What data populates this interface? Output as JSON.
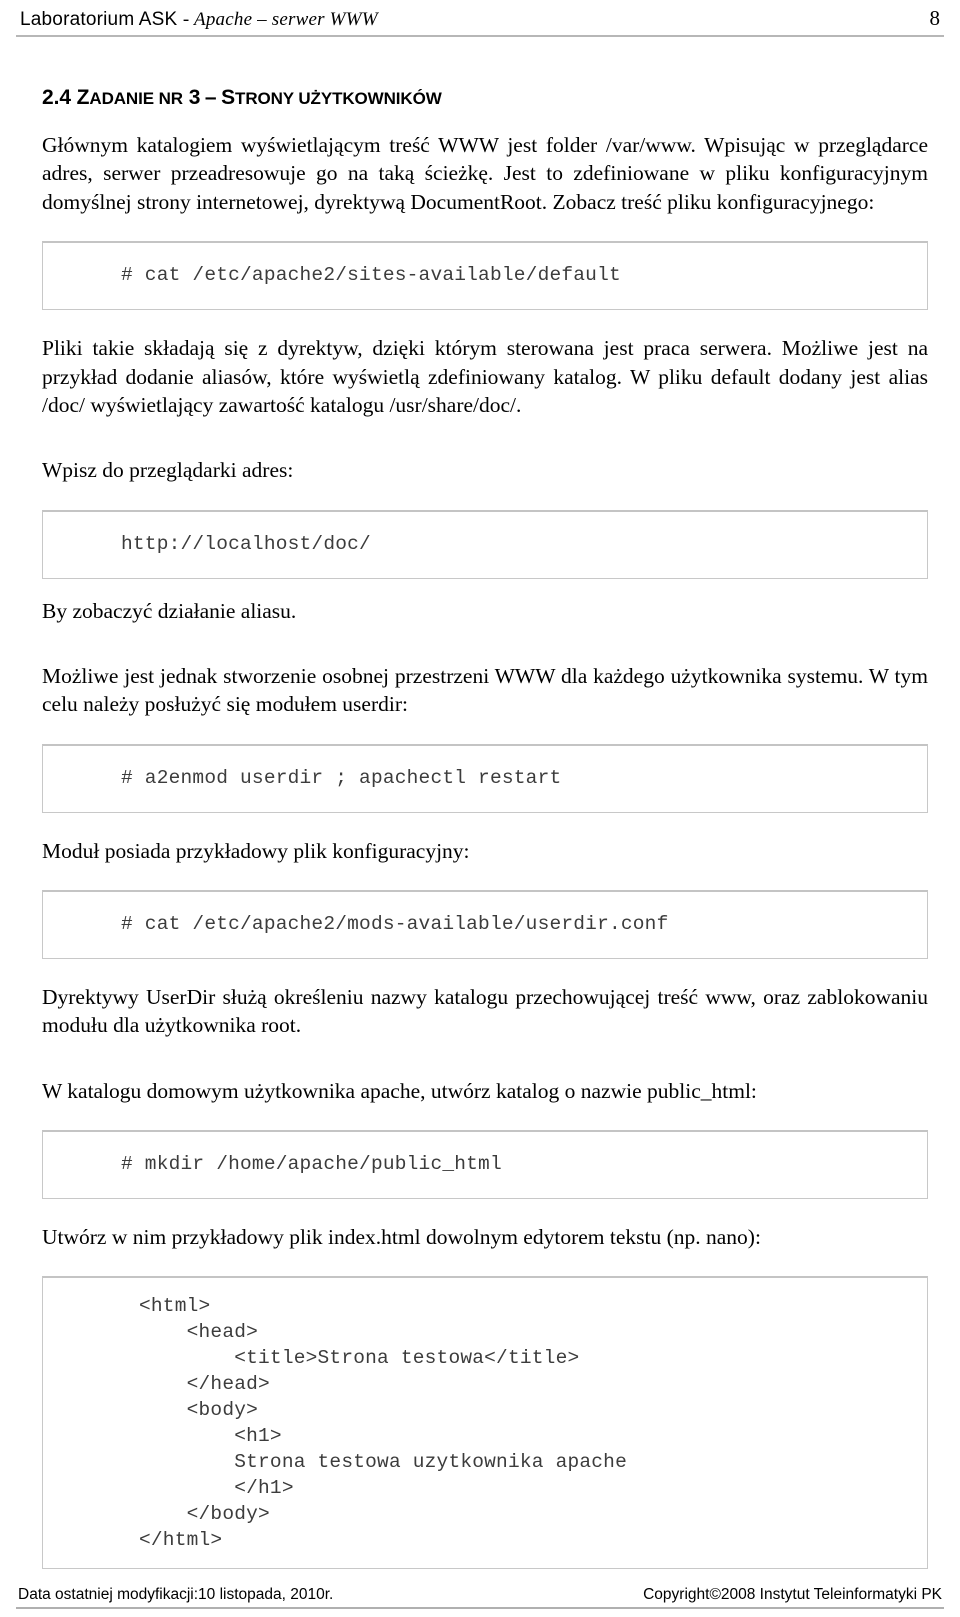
{
  "header": {
    "title_plain": "Laboratorium ASK",
    "title_italic": "- Apache – serwer WWW",
    "page_number": "8"
  },
  "section": {
    "number": "2.4",
    "title_full": "ZADANIE NR 3 – STRONY UŻYTKOWNIKÓW",
    "parts": {
      "z": "Z",
      "adanie_nr": "ADANIE NR",
      "three": "3",
      "dash": "–",
      "s": "S",
      "trony_uzytkownikow": "TRONY UŻYTKOWNIKÓW"
    }
  },
  "paragraphs": {
    "p1": "Głównym katalogiem wyświetlającym treść WWW jest folder /var/www. Wpisując w przeglądarce adres, serwer przeadresowuje go na taką ścieżkę. Jest to zdefiniowane w pliku konfiguracyjnym domyślnej strony internetowej, dyrektywą DocumentRoot. Zobacz treść pliku konfiguracyjnego:",
    "p2": "Pliki takie składają się z dyrektyw, dzięki którym sterowana jest praca serwera. Możliwe jest na przykład dodanie aliasów, które wyświetlą zdefiniowany katalog. W pliku default dodany jest alias /doc/ wyświetlający zawartość katalogu /usr/share/doc/.",
    "p3": "Wpisz do przeglądarki adres:",
    "p4": "By zobaczyć działanie aliasu.",
    "p5": "Możliwe jest jednak stworzenie osobnej przestrzeni WWW dla każdego użytkownika systemu. W tym celu należy posłużyć się modułem userdir:",
    "p6": "Moduł posiada przykładowy plik konfiguracyjny:",
    "p7": "Dyrektywy UserDir służą określeniu nazwy katalogu przechowującej treść www, oraz zablokowaniu modułu dla użytkownika root.",
    "p8": "W katalogu domowym użytkownika apache, utwórz katalog o nazwie public_html:",
    "p9": "Utwórz w nim przykładowy plik index.html dowolnym edytorem tekstu (np. nano):"
  },
  "code_blocks": {
    "cat_default": "# cat /etc/apache2/sites-available/default",
    "url_doc": "http://localhost/doc/",
    "a2enmod": "# a2enmod userdir ; apachectl restart",
    "cat_userdir": "# cat /etc/apache2/mods-available/userdir.conf",
    "mkdir_public_html": "# mkdir /home/apache/public_html",
    "index_html": "<html>\n    <head>\n        <title>Strona testowa</title>\n    </head>\n    <body>\n        <h1>\n        Strona testowa uzytkownika apache\n        </h1>\n    </body>\n</html>"
  },
  "footer": {
    "left": "Data ostatniej modyfikacji:10 listopada, 2010r.",
    "right": "Copyright©2008 Instytut Teleinformatyki PK"
  }
}
